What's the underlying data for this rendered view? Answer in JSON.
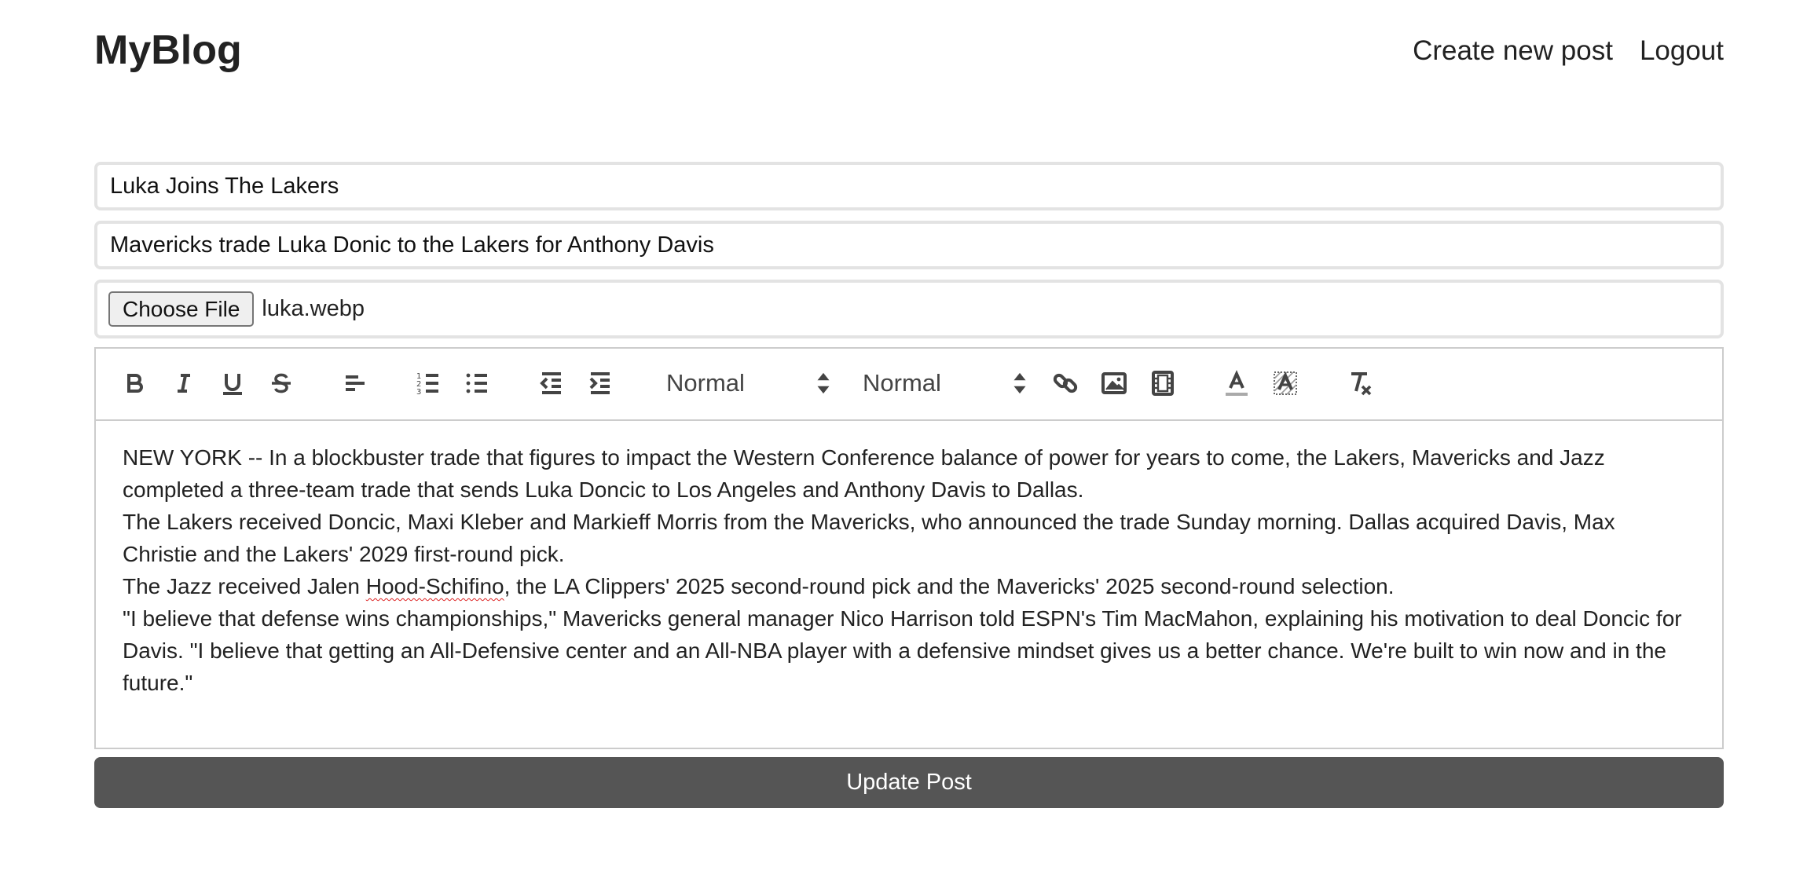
{
  "header": {
    "brand": "MyBlog",
    "nav": {
      "create_post": "Create new post",
      "logout": "Logout"
    }
  },
  "form": {
    "title_value": "Luka Joins The Lakers",
    "description_value": "Mavericks trade Luka Donic to the Lakers for Anthony Davis",
    "file": {
      "button_label": "Choose File",
      "file_name": "luka.webp"
    },
    "toolbar": {
      "icons": [
        "bold-icon",
        "italic-icon",
        "underline-icon",
        "strikethrough-icon",
        "align-left-icon",
        "ordered-list-icon",
        "bullet-list-icon",
        "outdent-icon",
        "indent-icon",
        "link-icon",
        "image-icon",
        "video-icon",
        "text-color-icon",
        "background-color-icon",
        "clear-format-icon"
      ],
      "heading_picker": "Normal",
      "size_picker": "Normal"
    },
    "content": {
      "paragraphs": [
        "NEW YORK -- In a blockbuster trade that figures to impact the Western Conference balance of power for years to come, the Lakers, Mavericks and Jazz completed a three-team trade that sends Luka Doncic to Los Angeles and Anthony Davis to Dallas.",
        "The Lakers received Doncic, Maxi Kleber and Markieff Morris from the Mavericks, who announced the trade Sunday morning. Dallas acquired Davis, Max Christie and the Lakers' 2029 first-round pick."
      ],
      "p3_before": "The Jazz received Jalen ",
      "p3_misspelled": "Hood-Schifino",
      "p3_after": ", the LA Clippers' 2025 second-round pick and the Mavericks' 2025 second-round selection.",
      "p4": "\"I believe that defense wins championships,\" Mavericks general manager Nico Harrison told ESPN's Tim MacMahon, explaining his motivation to deal Doncic for Davis. \"I believe that getting an All-Defensive center and an All-NBA player with a defensive mindset gives us a better chance. We're built to win now and in the future.\""
    },
    "submit_label": "Update Post"
  }
}
